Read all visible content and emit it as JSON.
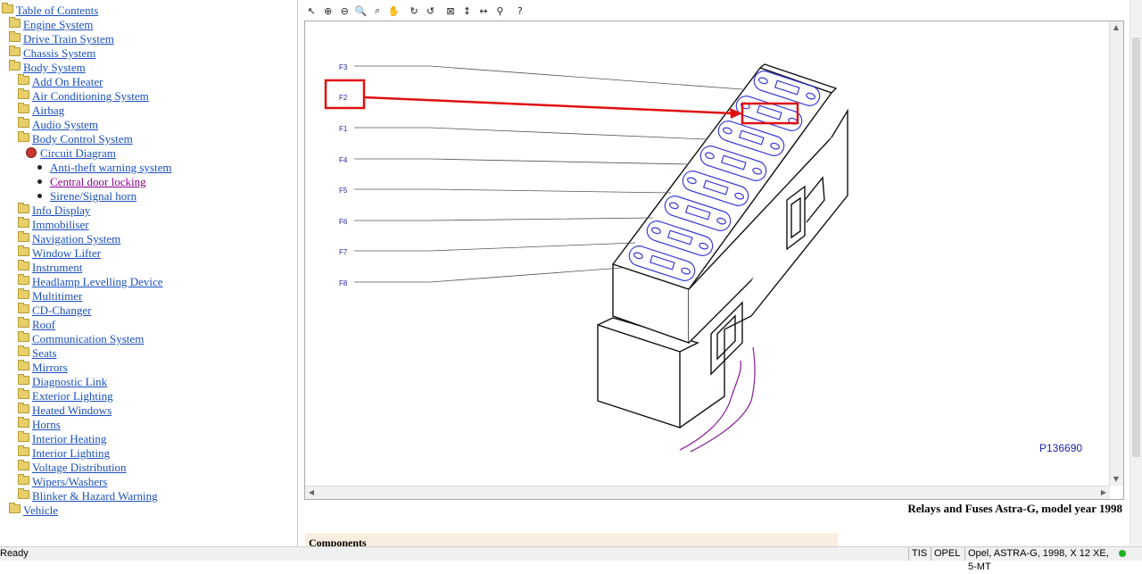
{
  "tree": {
    "nodes": [
      {
        "label": "Table of Contents",
        "depth": 0,
        "icon": "folder",
        "visited": false
      },
      {
        "label": "Engine System",
        "depth": 1,
        "icon": "folder",
        "visited": false
      },
      {
        "label": "Drive Train System",
        "depth": 1,
        "icon": "folder",
        "visited": false
      },
      {
        "label": "Chassis System",
        "depth": 1,
        "icon": "folder",
        "visited": false
      },
      {
        "label": "Body System",
        "depth": 1,
        "icon": "folder",
        "visited": false
      },
      {
        "label": "Add On Heater",
        "depth": 2,
        "icon": "folder",
        "visited": false
      },
      {
        "label": "Air Conditioning System",
        "depth": 2,
        "icon": "folder",
        "visited": false
      },
      {
        "label": "Airbag",
        "depth": 2,
        "icon": "folder",
        "visited": false
      },
      {
        "label": "Audio System",
        "depth": 2,
        "icon": "folder",
        "visited": false
      },
      {
        "label": "Body Control System",
        "depth": 2,
        "icon": "folder",
        "visited": false
      },
      {
        "label": "Circuit Diagram",
        "depth": 3,
        "icon": "diagram",
        "visited": false
      },
      {
        "label": "Anti-theft warning system",
        "depth": 4,
        "icon": "bullet",
        "visited": false
      },
      {
        "label": "Central door locking",
        "depth": 4,
        "icon": "bullet",
        "visited": true
      },
      {
        "label": "Sirene/Signal horn",
        "depth": 4,
        "icon": "bullet",
        "visited": false
      },
      {
        "label": "Info Display",
        "depth": 2,
        "icon": "folder",
        "visited": false
      },
      {
        "label": "Immobiliser",
        "depth": 2,
        "icon": "folder",
        "visited": false
      },
      {
        "label": "Navigation System",
        "depth": 2,
        "icon": "folder",
        "visited": false
      },
      {
        "label": "Window Lifter",
        "depth": 2,
        "icon": "folder",
        "visited": false
      },
      {
        "label": "Instrument",
        "depth": 2,
        "icon": "folder",
        "visited": false
      },
      {
        "label": "Headlamp Levelling Device",
        "depth": 2,
        "icon": "folder",
        "visited": false
      },
      {
        "label": "Multitimer",
        "depth": 2,
        "icon": "folder",
        "visited": false
      },
      {
        "label": "CD-Changer",
        "depth": 2,
        "icon": "folder",
        "visited": false
      },
      {
        "label": "Roof",
        "depth": 2,
        "icon": "folder",
        "visited": false
      },
      {
        "label": "Communication System",
        "depth": 2,
        "icon": "folder",
        "visited": false
      },
      {
        "label": "Seats",
        "depth": 2,
        "icon": "folder",
        "visited": false
      },
      {
        "label": "Mirrors",
        "depth": 2,
        "icon": "folder",
        "visited": false
      },
      {
        "label": "Diagnostic Link",
        "depth": 2,
        "icon": "folder",
        "visited": false
      },
      {
        "label": "Exterior Lighting",
        "depth": 2,
        "icon": "folder",
        "visited": false
      },
      {
        "label": "Heated Windows",
        "depth": 2,
        "icon": "folder",
        "visited": false
      },
      {
        "label": "Horns",
        "depth": 2,
        "icon": "folder",
        "visited": false
      },
      {
        "label": "Interior Heating",
        "depth": 2,
        "icon": "folder",
        "visited": false
      },
      {
        "label": "Interior Lighting",
        "depth": 2,
        "icon": "folder",
        "visited": false
      },
      {
        "label": "Voltage Distribution",
        "depth": 2,
        "icon": "folder",
        "visited": false
      },
      {
        "label": "Wipers/Washers",
        "depth": 2,
        "icon": "folder",
        "visited": false
      },
      {
        "label": "Blinker & Hazard Warning",
        "depth": 2,
        "icon": "folder",
        "visited": false
      },
      {
        "label": "Vehicle",
        "depth": 1,
        "icon": "folder",
        "visited": false
      }
    ]
  },
  "toolbar": {
    "tools": [
      {
        "name": "select-tool-icon",
        "glyph": "↖"
      },
      {
        "name": "zoom-in-icon",
        "glyph": "⊕"
      },
      {
        "name": "zoom-out-icon",
        "glyph": "⊖"
      },
      {
        "name": "zoom-icon",
        "glyph": "🔍"
      },
      {
        "name": "zoom-area-icon",
        "glyph": "⌕"
      },
      {
        "name": "pan-hand-icon",
        "glyph": "✋"
      },
      {
        "name": "rotate-cw-icon",
        "glyph": "↻"
      },
      {
        "name": "rotate-ccw-icon",
        "glyph": "↺"
      },
      {
        "name": "fit-window-icon",
        "glyph": "⊠"
      },
      {
        "name": "fit-height-icon",
        "glyph": "↕"
      },
      {
        "name": "fit-width-icon",
        "glyph": "↔"
      },
      {
        "name": "magnify-icon",
        "glyph": "⚲"
      },
      {
        "name": "help-icon",
        "glyph": "?"
      }
    ]
  },
  "diagram": {
    "fuse_labels": [
      "F3",
      "F2",
      "F1",
      "F4",
      "F5",
      "F6",
      "F7",
      "F8"
    ],
    "highlighted": "F2",
    "part_number": "P136690",
    "colors": {
      "line": "#3b3bd6",
      "highlight": "#e01010",
      "wire": "#8a2a9a"
    }
  },
  "caption": "Relays and Fuses Astra-G, model year 1998",
  "components_header": "Components",
  "status": {
    "ready": "Ready",
    "app": "TIS",
    "make": "OPEL",
    "vehicle": "Opel, ASTRA-G, 1998, X 12 XE, 5-MT"
  }
}
